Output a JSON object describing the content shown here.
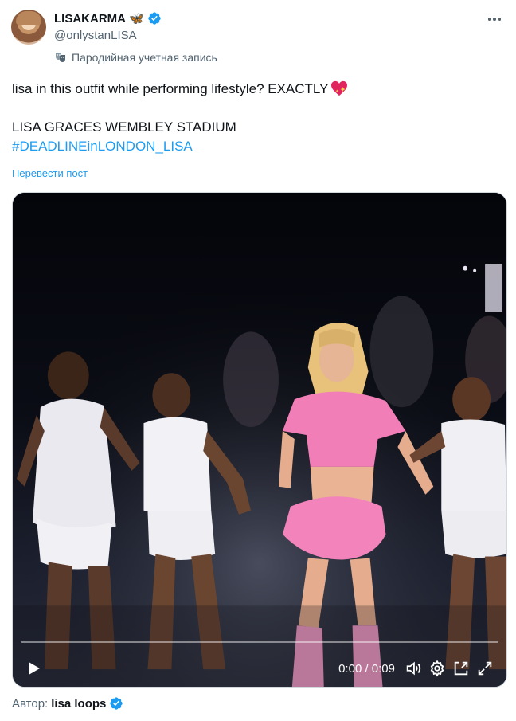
{
  "author": {
    "display_name": "LISAKARMA",
    "name_emoji": "butterfly",
    "handle": "@onlystanLISA",
    "verified": true,
    "parody_label": "Пародийная учетная запись"
  },
  "tweet": {
    "line1": "lisa in this outfit while performing lifestyle? EXACTLY",
    "line1_emoji": "sparkling-heart",
    "line2": "LISA GRACES WEMBLEY STADIUM",
    "hashtag": "#DEADLINEinLONDON_LISA",
    "translate_label": "Перевести пост"
  },
  "video": {
    "time_display": "0:00 / 0:09",
    "progress": 0,
    "controls": [
      "play-icon",
      "volume-icon",
      "settings-icon",
      "pip-icon",
      "fullscreen-icon"
    ]
  },
  "attribution": {
    "prefix": "Автор:",
    "name": "lisa loops",
    "verified": true
  },
  "colors": {
    "link": "#1d9bf0",
    "text": "#0f1419",
    "secondary": "#536471",
    "verified": "#1d9bf0"
  }
}
